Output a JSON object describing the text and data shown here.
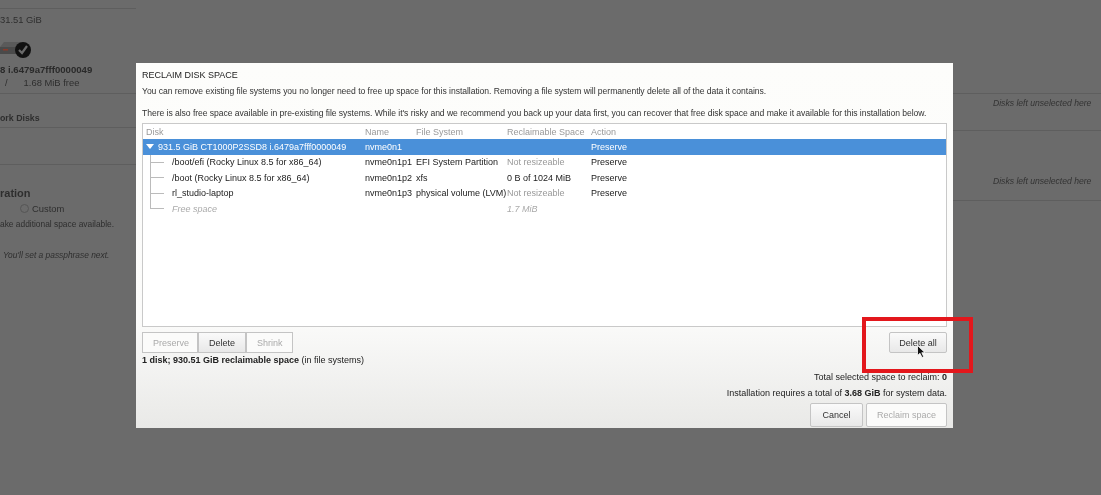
{
  "background": {
    "capacity": "31.51 GiB",
    "disk": {
      "checked": true
    },
    "disk_id": "8 i.6479a7fff0000049",
    "mount": "/",
    "free": "1.68 MiB free",
    "section": "ork Disks",
    "config_heading": "ration",
    "radio": {
      "label": "Custom",
      "selected": false
    },
    "hint": "ake additional space available.",
    "passphrase_note": "You'll set a passphrase next.",
    "notes": [
      "Disks left unselected here",
      "Disks left unselected here"
    ]
  },
  "dialog": {
    "title": "RECLAIM DISK SPACE",
    "paragraphs": [
      "You can remove existing file systems you no longer need to free up space for this installation.  Removing a file system will permanently delete all of the data it contains.",
      "There is also free space available in pre-existing file systems.  While it's risky and we recommend you back up your data first, you can recover that free disk space and make it available for this installation below."
    ],
    "table": {
      "columns": [
        "Disk",
        "Name",
        "File System",
        "Reclaimable Space",
        "Action"
      ],
      "rows": [
        {
          "kind": "disk",
          "disk": "931.5 GiB CT1000P2SSD8 i.6479a7fff0000049",
          "name": "nvme0n1",
          "action": "Preserve",
          "selected": true,
          "expanded": true,
          "children": [
            {
              "kind": "partition",
              "disk": "/boot/efi (Rocky Linux 8.5 for x86_64)",
              "name": "nvme0n1p1",
              "file_system": "EFI System Partition",
              "reclaimable_space": "Not resizeable",
              "resizable": false,
              "action": "Preserve",
              "selected": false
            },
            {
              "kind": "partition",
              "disk": "/boot (Rocky Linux 8.5 for x86_64)",
              "name": "nvme0n1p2",
              "file_system": "xfs",
              "reclaimable_space": "0 B of 1024 MiB",
              "resizable": true,
              "action": "Preserve",
              "selected": false
            },
            {
              "kind": "partition",
              "disk": "rl_studio-laptop",
              "name": "nvme0n1p3",
              "file_system": "physical volume (LVM)",
              "reclaimable_space": "Not resizeable",
              "resizable": false,
              "action": "Preserve",
              "selected": false
            },
            {
              "kind": "free",
              "disk": "Free space",
              "reclaimable_space": "1.7 MiB",
              "selected": false
            }
          ]
        }
      ]
    },
    "row_actions": [
      {
        "label": "Preserve",
        "disabled": true
      },
      {
        "label": "Delete",
        "disabled": false
      },
      {
        "label": "Shrink",
        "disabled": true
      }
    ],
    "summary": "**1 disk; 930.51 GiB reclaimable space** (in file systems)",
    "delete_all": {
      "label": "Delete all",
      "disabled": false
    },
    "totals": [
      "Total selected space to reclaim: **0**",
      "Installation requires a total of **3.68 GiB** for system data."
    ],
    "buttons": [
      {
        "label": "Cancel",
        "disabled": false
      },
      {
        "label": "Reclaim space",
        "disabled": true
      }
    ]
  }
}
